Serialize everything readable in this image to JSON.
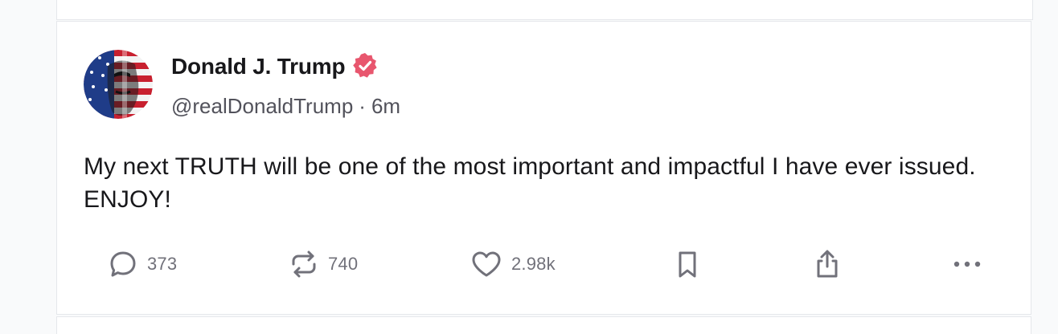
{
  "post": {
    "author": {
      "display_name": "Donald J. Trump",
      "handle": "@realDonaldTrump",
      "verified": true,
      "verified_color": "#e8566e"
    },
    "timestamp_separator": "·",
    "timestamp": "6m",
    "text": "My next TRUTH will be one of the most important and impactful I have ever issued. ENJOY!",
    "actions": {
      "reply": {
        "icon": "reply-icon",
        "count": "373"
      },
      "retruth": {
        "icon": "retruth-icon",
        "count": "740"
      },
      "like": {
        "icon": "heart-icon",
        "count": "2.98k"
      },
      "bookmark": {
        "icon": "bookmark-icon"
      },
      "share": {
        "icon": "share-icon"
      },
      "more": {
        "icon": "more-icon"
      }
    }
  },
  "colors": {
    "text_primary": "#18181b",
    "text_secondary": "#52525b",
    "icon_gray": "#71717a",
    "card_border": "#e5e7eb",
    "background": "#f9fafb"
  }
}
